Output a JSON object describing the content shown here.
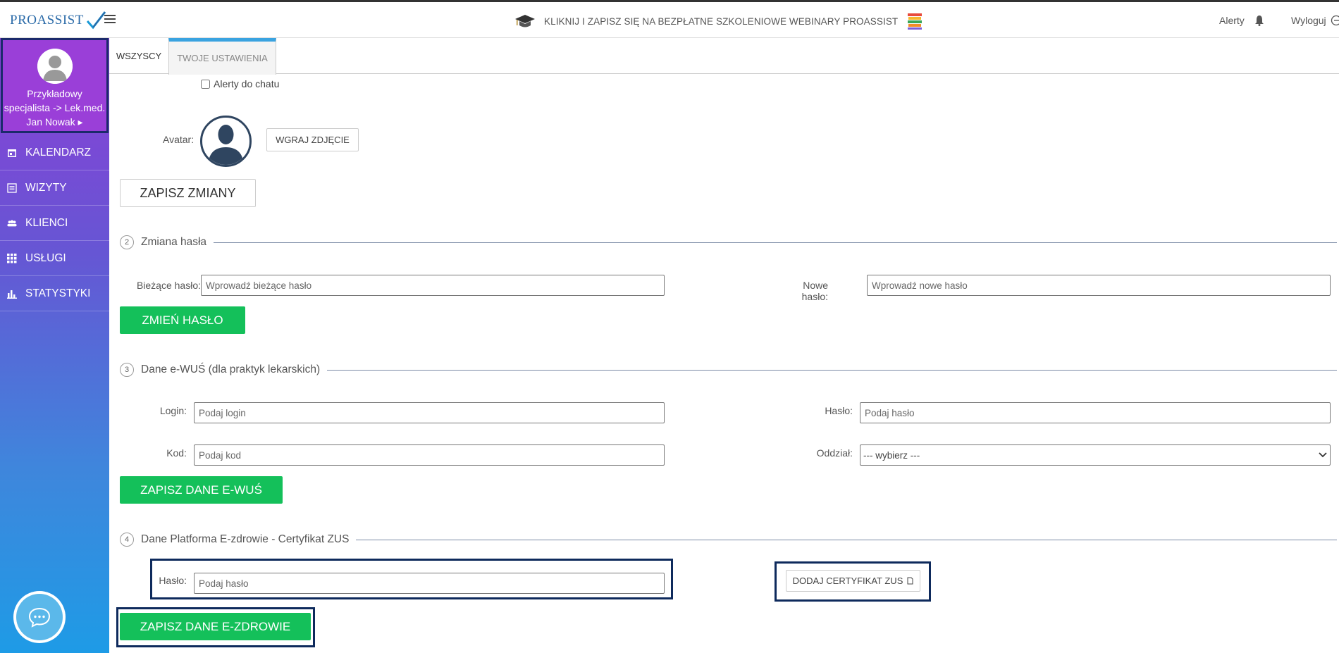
{
  "header": {
    "logo_text": "PROASSIST",
    "banner_text": "KLIKNIJ I ZAPISZ SIĘ NA BEZPŁATNE SZKOLENIOWE WEBINARY PROASSIST",
    "alerts_label": "Alerty",
    "logout_label": "Wyloguj"
  },
  "sidebar": {
    "profile": {
      "line1": "Przykładowy",
      "line2": "specjalista -> Lek.med.",
      "line3": "Jan Nowak ▸"
    },
    "items": [
      {
        "label": "KALENDARZ",
        "icon": "calendar-icon"
      },
      {
        "label": "WIZYTY",
        "icon": "list-icon"
      },
      {
        "label": "KLIENCI",
        "icon": "users-icon"
      },
      {
        "label": "USŁUGI",
        "icon": "grid-icon"
      },
      {
        "label": "STATYSTYKI",
        "icon": "bar-chart-icon"
      }
    ]
  },
  "tabs": {
    "all": "WSZYSCY",
    "settings": "TWOJE USTAWIENIA"
  },
  "settings": {
    "chat_alerts_label": "Alerty do chatu",
    "avatar_label": "Avatar:",
    "upload_photo": "WGRAJ ZDJĘCIE",
    "save_changes": "ZAPISZ ZMIANY"
  },
  "password_section": {
    "number": "2",
    "title": "Zmiana hasła",
    "current_label": "Bieżące hasło:",
    "current_placeholder": "Wprowadź bieżące hasło",
    "new_label": "Nowe hasło:",
    "new_placeholder": "Wprowadź nowe hasło",
    "submit": "ZMIEŃ HASŁO"
  },
  "ewus_section": {
    "number": "3",
    "title": "Dane e-WUŚ (dla praktyk lekarskich)",
    "login_label": "Login:",
    "login_placeholder": "Podaj login",
    "password_label": "Hasło:",
    "password_placeholder": "Podaj hasło",
    "code_label": "Kod:",
    "code_placeholder": "Podaj kod",
    "branch_label": "Oddział:",
    "branch_value": "--- wybierz ---",
    "submit": "ZAPISZ DANE E-WUŚ"
  },
  "ezdrowie_section": {
    "number": "4",
    "title": "Dane Platforma E-zdrowie - Certyfikat ZUS",
    "password_label": "Hasło:",
    "password_placeholder": "Podaj hasło",
    "add_cert": "DODAJ CERTYFIKAT ZUS",
    "submit": "ZAPISZ DANE E-ZDROWIE"
  },
  "colors": {
    "accent_green": "#14c05a",
    "tab_accent": "#3aa3e0",
    "highlight_border": "#0e2a5c"
  }
}
